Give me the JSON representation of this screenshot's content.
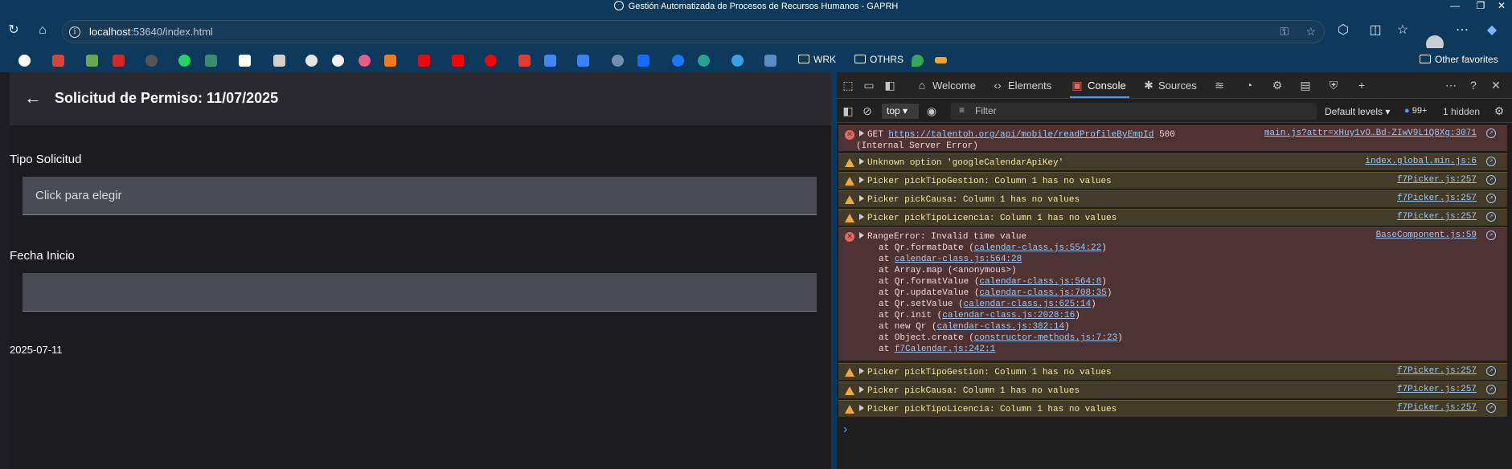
{
  "window": {
    "title": "Gestión Automatizada de Procesos de Recursos Humanos - GAPRH",
    "controls": [
      "minimize",
      "restore",
      "close"
    ]
  },
  "browser": {
    "url_host": "localhost",
    "url_rest": ":53640/index.html",
    "toolbar_icons": [
      "refresh-icon",
      "home-icon",
      "extensions-icon",
      "split-screen-icon",
      "favorites-icon",
      "collections-icon",
      "profile-avatar",
      "more-icon",
      "copilot-icon"
    ]
  },
  "bookmarks": {
    "icons": [
      "google",
      "gmail",
      "app",
      "app",
      "app",
      "whatsapp",
      "app",
      "amazon",
      "app",
      "chatgpt",
      "github",
      "app",
      "app",
      "netflix",
      "youtube",
      "youtube-music",
      "app",
      "translate",
      "app",
      "app",
      "behance",
      "facebook",
      "app",
      "app",
      "app"
    ],
    "folders": [
      "WRK",
      "OTHRS"
    ],
    "other_favorites": "Other favorites"
  },
  "app": {
    "page_title": "Solicitud de Permiso: 11/07/2025",
    "tipo_label": "Tipo Solicitud",
    "tipo_placeholder": "Click para elegir",
    "fecha_label": "Fecha Inicio",
    "fecha_value": "",
    "date_text": "2025-07-11"
  },
  "devtools": {
    "tabs": [
      "Welcome",
      "Elements",
      "Console",
      "Sources"
    ],
    "active_tab": "Console",
    "context": "top",
    "filter_placeholder": "Filter",
    "levels": "Default levels",
    "issues_count": "99+",
    "hidden": "1 hidden",
    "messages": [
      {
        "level": "error",
        "text_pre": "GET ",
        "link": "https://talentoh.org/api/mobile/readProfileByEmpId",
        "text_post": " 500",
        "text2": "(Internal Server Error)",
        "source": "main.js?attr=xHuy1vO…Bd-ZIwV9L1Q8Xg:3071"
      },
      {
        "level": "warning",
        "text": "Unknown option 'googleCalendarApiKey'",
        "source": "index.global.min.js:6"
      },
      {
        "level": "warning",
        "text": "Picker pickTipoGestion: Column 1 has no values",
        "source": "f7Picker.js:257"
      },
      {
        "level": "warning",
        "text": "Picker pickCausa: Column 1 has no values",
        "source": "f7Picker.js:257"
      },
      {
        "level": "warning",
        "text": "Picker pickTipoLicencia: Column 1 has no values",
        "source": "f7Picker.js:257"
      },
      {
        "level": "error",
        "text": "RangeError: Invalid time value",
        "source": "BaseComponent.js:59",
        "stack": [
          {
            "pre": "at Qr.formatDate (",
            "link": "calendar-class.js:554:22",
            "post": ")"
          },
          {
            "pre": "at ",
            "link": "calendar-class.js:564:28",
            "post": ""
          },
          {
            "pre": "at Array.map (<anonymous>)",
            "link": "",
            "post": ""
          },
          {
            "pre": "at Qr.formatValue (",
            "link": "calendar-class.js:564:8",
            "post": ")"
          },
          {
            "pre": "at Qr.updateValue (",
            "link": "calendar-class.js:708:35",
            "post": ")"
          },
          {
            "pre": "at Qr.setValue (",
            "link": "calendar-class.js:625:14",
            "post": ")"
          },
          {
            "pre": "at Qr.init (",
            "link": "calendar-class.js:2028:16",
            "post": ")"
          },
          {
            "pre": "at new Qr (",
            "link": "calendar-class.js:382:14",
            "post": ")"
          },
          {
            "pre": "at Object.create (",
            "link": "constructor-methods.js:7:23",
            "post": ")"
          },
          {
            "pre": "at ",
            "link": "f7Calendar.js:242:1",
            "post": ""
          }
        ]
      },
      {
        "level": "warning",
        "text": "Picker pickTipoGestion: Column 1 has no values",
        "source": "f7Picker.js:257"
      },
      {
        "level": "warning",
        "text": "Picker pickCausa: Column 1 has no values",
        "source": "f7Picker.js:257"
      },
      {
        "level": "warning",
        "text": "Picker pickTipoLicencia: Column 1 has no values",
        "source": "f7Picker.js:257"
      }
    ]
  }
}
